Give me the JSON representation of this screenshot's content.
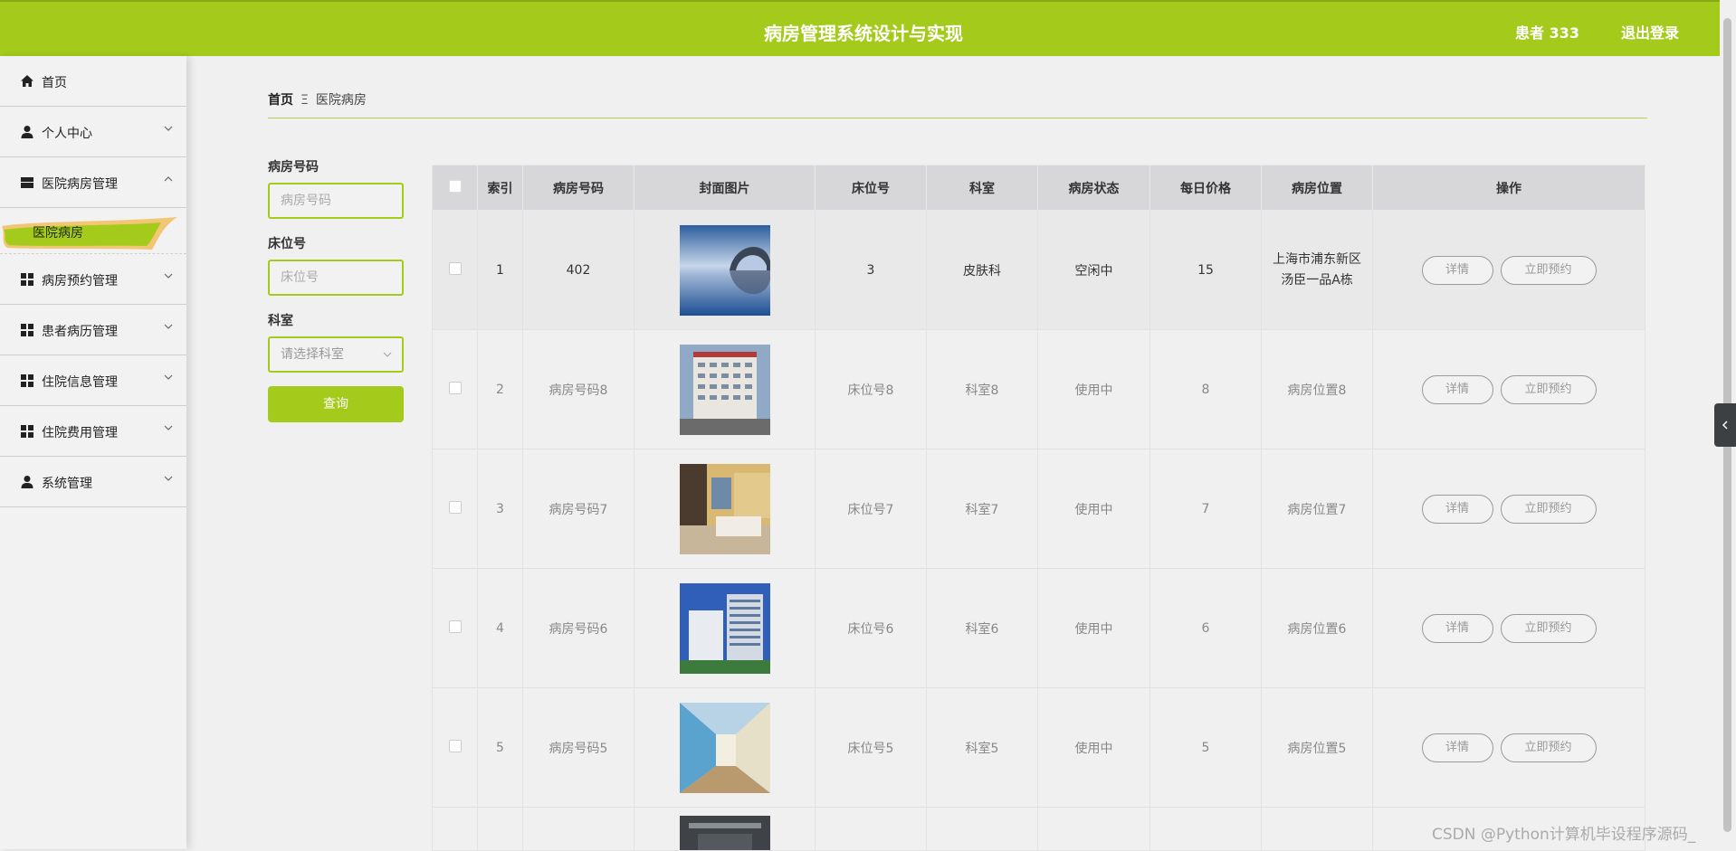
{
  "header": {
    "title": "病房管理系统设计与实现",
    "user": "患者 333",
    "logout": "退出登录",
    "color": "#a4cb1c"
  },
  "sidebar": {
    "items": [
      {
        "label": "首页",
        "icon": "home-icon"
      },
      {
        "label": "个人中心",
        "icon": "user-icon"
      },
      {
        "label": "医院病房管理",
        "icon": "folder-icon",
        "expanded": true
      },
      {
        "label": "病房预约管理",
        "icon": "grid-icon"
      },
      {
        "label": "患者病历管理",
        "icon": "grid-icon"
      },
      {
        "label": "住院信息管理",
        "icon": "grid-icon"
      },
      {
        "label": "住院费用管理",
        "icon": "grid-icon"
      },
      {
        "label": "系统管理",
        "icon": "admin-icon"
      }
    ],
    "active_sub": "医院病房"
  },
  "breadcrumb": {
    "home": "首页",
    "sep": "Ξ",
    "current": "医院病房"
  },
  "search": {
    "room_label": "病房号码",
    "room_placeholder": "病房号码",
    "bed_label": "床位号",
    "bed_placeholder": "床位号",
    "dept_label": "科室",
    "dept_placeholder": "请选择科室",
    "query_button": "查询"
  },
  "table": {
    "headers": [
      "索引",
      "病房号码",
      "封面图片",
      "床位号",
      "科室",
      "病房状态",
      "每日价格",
      "病房位置",
      "操作"
    ],
    "rows": [
      {
        "index": "1",
        "room": "402",
        "image": "bridge-lake-photo",
        "bed": "3",
        "dept": "皮肤科",
        "status": "空闲中",
        "price": "15",
        "loc1": "上海市浦东新区",
        "loc2": "汤臣一品A栋"
      },
      {
        "index": "2",
        "room": "病房号码8",
        "image": "hospital-building-photo",
        "bed": "床位号8",
        "dept": "科室8",
        "status": "使用中",
        "price": "8",
        "loc1": "病房位置8",
        "loc2": ""
      },
      {
        "index": "3",
        "room": "病房号码7",
        "image": "ward-room-photo",
        "bed": "床位号7",
        "dept": "科室7",
        "status": "使用中",
        "price": "7",
        "loc1": "病房位置7",
        "loc2": ""
      },
      {
        "index": "4",
        "room": "病房号码6",
        "image": "modern-hospital-photo",
        "bed": "床位号6",
        "dept": "科室6",
        "status": "使用中",
        "price": "6",
        "loc1": "病房位置6",
        "loc2": ""
      },
      {
        "index": "5",
        "room": "病房号码5",
        "image": "corridor-photo",
        "bed": "床位号5",
        "dept": "科室5",
        "status": "使用中",
        "price": "5",
        "loc1": "病房位置5",
        "loc2": ""
      }
    ],
    "detail_label": "详情",
    "book_label": "立即预约"
  },
  "watermark": "CSDN @Python计算机毕设程序源码_"
}
